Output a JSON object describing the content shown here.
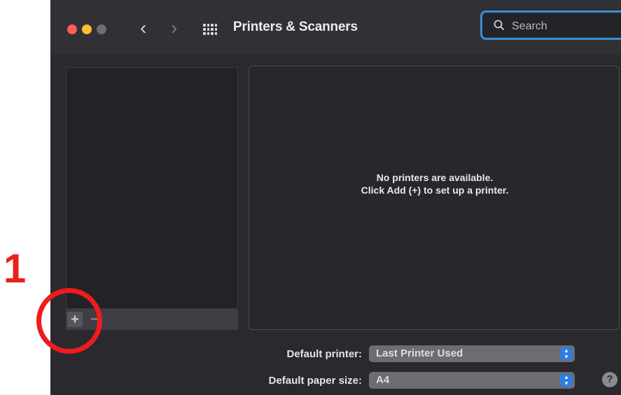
{
  "window": {
    "title": "Printers & Scanners",
    "nav_back": "‹",
    "nav_forward": "›"
  },
  "search": {
    "placeholder": "Search",
    "value": ""
  },
  "printer_list": {
    "add_label": "+",
    "remove_label": "−"
  },
  "detail": {
    "empty_line1": "No printers are available.",
    "empty_line2": "Click Add (+) to set up a printer."
  },
  "settings": {
    "default_printer_label": "Default printer:",
    "default_printer_value": "Last Printer Used",
    "paper_size_label": "Default paper size:",
    "paper_size_value": "A4"
  },
  "help_label": "?",
  "annotation": {
    "step_number": "1"
  },
  "colors": {
    "annotation_red": "#ee1c1c",
    "search_focus": "#3b8ed6",
    "stepper_blue": "#2f7de1"
  }
}
